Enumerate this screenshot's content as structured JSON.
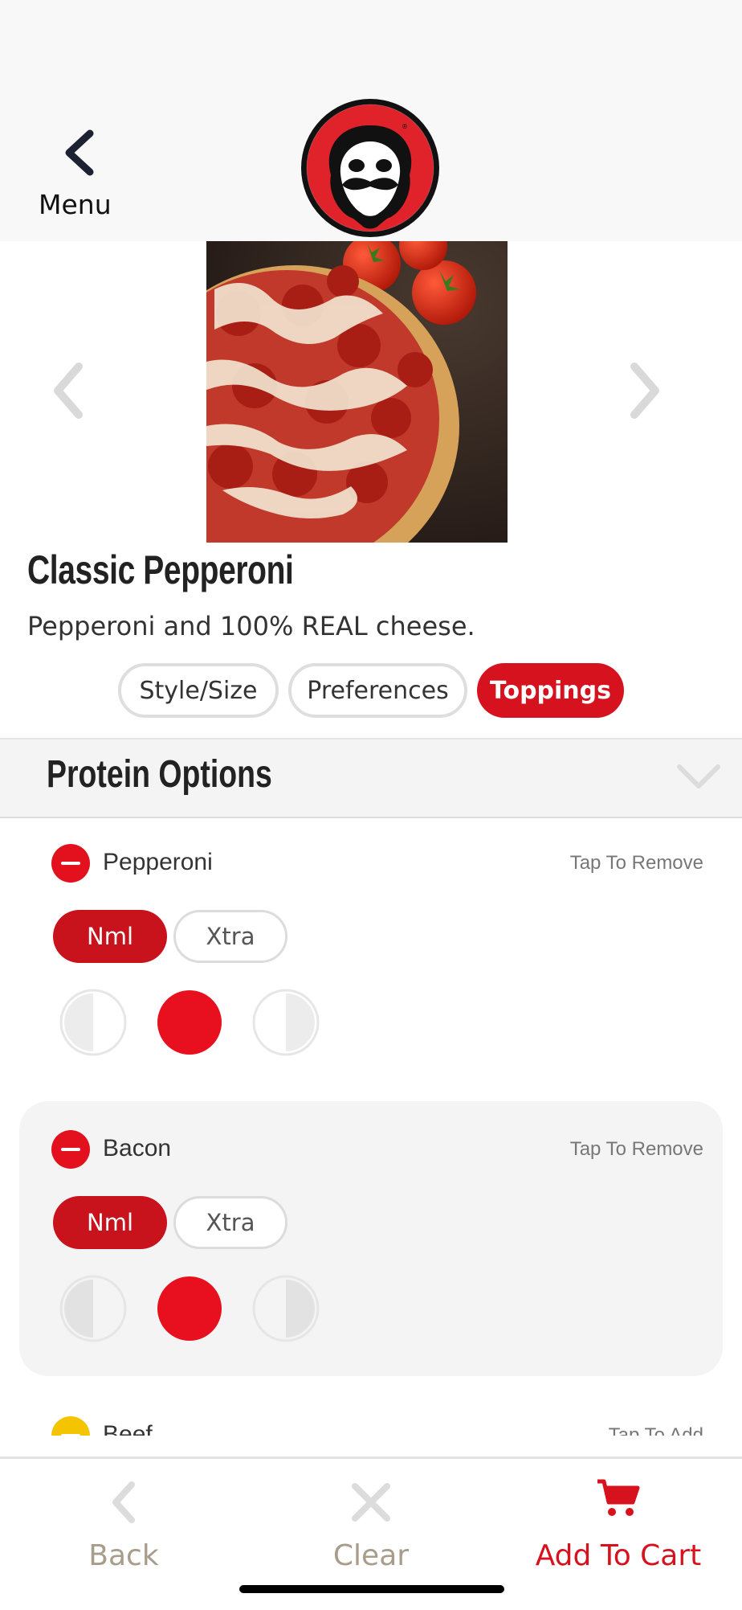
{
  "header": {
    "back_label": "Menu",
    "logo": "papa-murphys-logo"
  },
  "product": {
    "name": "Classic Pepperoni",
    "description": "Pepperoni and 100% REAL cheese."
  },
  "tabs": [
    {
      "label": "Style/Size",
      "active": false
    },
    {
      "label": "Preferences",
      "active": false
    },
    {
      "label": "Toppings",
      "active": true
    }
  ],
  "section": {
    "title": "Protein Options"
  },
  "toppings": [
    {
      "name": "Pepperoni",
      "action": "Tap To Remove",
      "state": "selected",
      "amounts": [
        "Nml",
        "Xtra"
      ],
      "selected_amount": "Nml",
      "coverage": "whole"
    },
    {
      "name": "Bacon",
      "action": "Tap To Remove",
      "state": "selected",
      "amounts": [
        "Nml",
        "Xtra"
      ],
      "selected_amount": "Nml",
      "coverage": "whole"
    },
    {
      "name": "Beef",
      "action": "Tap To Add",
      "state": "unselected"
    }
  ],
  "bottom_bar": {
    "back_label": "Back",
    "clear_label": "Clear",
    "cart_label": "Add To Cart"
  },
  "colors": {
    "brand_red": "#d6121e",
    "muted_text": "#a89c8a",
    "add_yellow": "#f5c400"
  }
}
